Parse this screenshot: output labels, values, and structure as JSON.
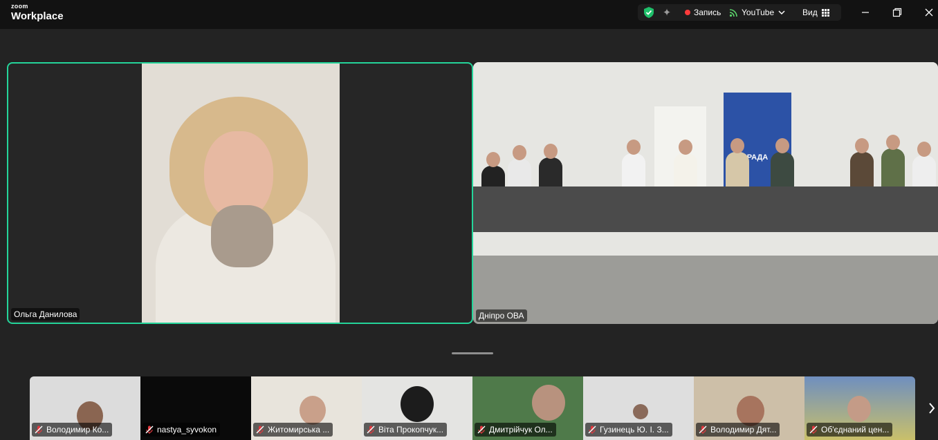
{
  "app": {
    "brand_top": "zoom",
    "brand_bottom": "Workplace"
  },
  "toolbar": {
    "record_label": "Запись",
    "stream_label": "YouTube",
    "view_label": "Вид"
  },
  "main": {
    "tiles": [
      {
        "name": "Ольга Данилова",
        "active_speaker": true
      },
      {
        "name": "Дніпро ОВА",
        "banner_text": "РАДА"
      }
    ]
  },
  "thumbnails": [
    {
      "name": "Володимир Ко...",
      "muted": true
    },
    {
      "name": "nastya_syvokon",
      "muted": true
    },
    {
      "name": "Житомирська ...",
      "muted": true
    },
    {
      "name": "Віта Прокопчук...",
      "muted": true
    },
    {
      "name": "Дмитрійчук Ол...",
      "muted": true
    },
    {
      "name": "Гузинець Ю. І. З...",
      "muted": true
    },
    {
      "name": "Володимир Дят...",
      "muted": true
    },
    {
      "name": "Об'єднаний цен...",
      "muted": true
    }
  ],
  "colors": {
    "active_border": "#24d59a",
    "record_dot": "#ff3b3b",
    "shield": "#1fbf6a",
    "muted_mic": "#e0383e"
  }
}
